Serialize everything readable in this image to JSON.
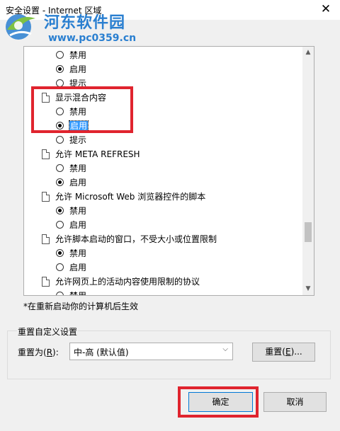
{
  "window": {
    "title": "安全设置 - Internet 区域",
    "close_glyph": "✕"
  },
  "watermark": {
    "site_name": "河东软件园",
    "url": "www.pc0359.cn"
  },
  "settings_list": [
    {
      "kind": "radio",
      "label": "禁用",
      "checked": false
    },
    {
      "kind": "radio",
      "label": "启用",
      "checked": true
    },
    {
      "kind": "radio",
      "label": "提示",
      "checked": false
    },
    {
      "kind": "header",
      "label": "显示混合内容"
    },
    {
      "kind": "radio",
      "label": "禁用",
      "checked": false
    },
    {
      "kind": "radio",
      "label": "启用",
      "checked": true,
      "selected": true
    },
    {
      "kind": "radio",
      "label": "提示",
      "checked": false
    },
    {
      "kind": "header",
      "label": "允许 META REFRESH"
    },
    {
      "kind": "radio",
      "label": "禁用",
      "checked": false
    },
    {
      "kind": "radio",
      "label": "启用",
      "checked": true
    },
    {
      "kind": "header",
      "label": "允许 Microsoft Web 浏览器控件的脚本"
    },
    {
      "kind": "radio",
      "label": "禁用",
      "checked": true
    },
    {
      "kind": "radio",
      "label": "启用",
      "checked": false
    },
    {
      "kind": "header",
      "label": "允许脚本启动的窗口，不受大小或位置限制"
    },
    {
      "kind": "radio",
      "label": "禁用",
      "checked": true
    },
    {
      "kind": "radio",
      "label": "启用",
      "checked": false
    },
    {
      "kind": "header",
      "label": "允许网页上的活动内容使用限制的协议"
    },
    {
      "kind": "radio",
      "label": "禁用",
      "checked": false
    }
  ],
  "scroll": {
    "position": 0.72
  },
  "note": "*在重新启动你的计算机后生效",
  "reset_group": {
    "legend": "重置自定义设置",
    "reset_to_label": "重置为",
    "reset_to_hotkey": "R",
    "selected_level": "中-高 (默认值)",
    "reset_button": "重置",
    "reset_button_hotkey": "E"
  },
  "buttons": {
    "ok": "确定",
    "cancel": "取消"
  },
  "colors": {
    "highlight": "#e0242e",
    "selection": "#3399ff",
    "watermark": "#2a7fd0"
  }
}
